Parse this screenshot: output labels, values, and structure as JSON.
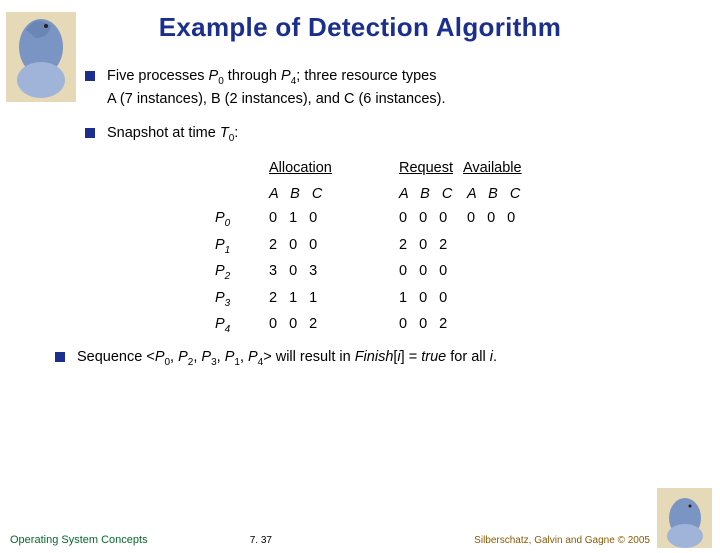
{
  "title": "Example of Detection Algorithm",
  "bullets": {
    "b1_a": "Five processes ",
    "b1_p0": "P",
    "b1_p0sub": "0",
    "b1_mid": " through ",
    "b1_p4": "P",
    "b1_p4sub": "4",
    "b1_b": "; three resource types",
    "b1_line2": "A (7 instances), B (2 instances), and C (6 instances).",
    "b2_a": "Snapshot at time ",
    "b2_t": "T",
    "b2_tsub": "0",
    "b2_b": ":",
    "b3_a": "Sequence <",
    "b3_seq": [
      "P",
      "0",
      "P",
      "2",
      "P",
      "3",
      "P",
      "1",
      "P",
      "4"
    ],
    "b3_b": "> will result in ",
    "b3_fin": "Finish",
    "b3_c": "[",
    "b3_i": "i",
    "b3_d": "] = ",
    "b3_true": "true",
    "b3_e": " for all ",
    "b3_i2": "i",
    "b3_f": "."
  },
  "headers": {
    "allocation": "Allocation",
    "request": "Request",
    "available": "Available"
  },
  "abc": "A B C",
  "rows": [
    {
      "label": "P",
      "sub": "0",
      "alloc": "0 1 0",
      "req": "0 0 0",
      "avail": "0 0 0"
    },
    {
      "label": "P",
      "sub": "1",
      "alloc": "2 0 0",
      "req": "2 0 2",
      "avail": ""
    },
    {
      "label": "P",
      "sub": "2",
      "alloc": "3 0 3",
      "req": "0 0 0",
      "avail": ""
    },
    {
      "label": "P",
      "sub": "3",
      "alloc": "2 1 1",
      "req": "1 0 0",
      "avail": ""
    },
    {
      "label": "P",
      "sub": "4",
      "alloc": "0 0 2",
      "req": "0 0 2",
      "avail": ""
    }
  ],
  "chart_data": {
    "type": "table",
    "title": "Detection Algorithm Snapshot at T0",
    "resources": {
      "A": 7,
      "B": 2,
      "C": 6
    },
    "processes": [
      {
        "name": "P0",
        "allocation": [
          0,
          1,
          0
        ],
        "request": [
          0,
          0,
          0
        ]
      },
      {
        "name": "P1",
        "allocation": [
          2,
          0,
          0
        ],
        "request": [
          2,
          0,
          2
        ]
      },
      {
        "name": "P2",
        "allocation": [
          3,
          0,
          3
        ],
        "request": [
          0,
          0,
          0
        ]
      },
      {
        "name": "P3",
        "allocation": [
          2,
          1,
          1
        ],
        "request": [
          1,
          0,
          0
        ]
      },
      {
        "name": "P4",
        "allocation": [
          0,
          0,
          2
        ],
        "request": [
          0,
          0,
          2
        ]
      }
    ],
    "available": [
      0,
      0,
      0
    ],
    "safe_sequence": [
      "P0",
      "P2",
      "P3",
      "P1",
      "P4"
    ]
  },
  "footer": {
    "left": "Operating System Concepts",
    "mid": "7. 37",
    "right": "Silberschatz, Galvin and Gagne © 2005"
  }
}
